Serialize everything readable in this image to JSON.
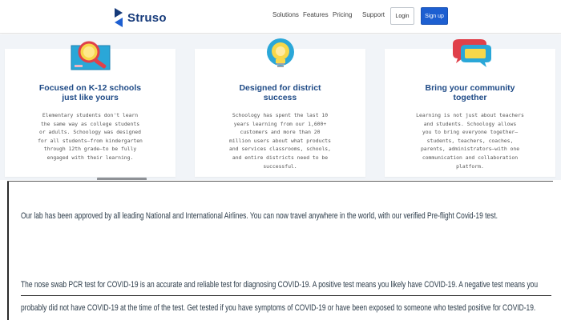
{
  "header": {
    "brand": "Struso",
    "nav": [
      "Solutions",
      "Features",
      "Pricing",
      "Support"
    ],
    "login_label": "Login",
    "signup_label": "Sign up",
    "colors": {
      "brand_blue": "#1d5fd1",
      "logo_dark": "#163a7a"
    }
  },
  "features": [
    {
      "title_line1": "Focused on K-12 schools",
      "title_line2": "just like yours",
      "icon": "magnifier-illustration-icon",
      "desc": [
        "Elementary students don't learn",
        "the same way as college students",
        "or adults. Schoology was designed",
        "for all students—from kindergarten",
        "through 12th grade—to be fully",
        "engaged with their learning."
      ]
    },
    {
      "title_line1": "Designed for district",
      "title_line2": "success",
      "icon": "lightbulb-illustration-icon",
      "desc": [
        "Schoology has spent the last 10",
        "years learning from our 1,600+",
        "customers and more than 20",
        "million users about what products",
        "and services classrooms, schools,",
        "and entire districts need to be",
        "successful."
      ]
    },
    {
      "title_line1": "Bring your community",
      "title_line2": "together",
      "icon": "chat-bubbles-illustration-icon",
      "desc": [
        "Learning is not just about teachers",
        "and students. Schoology allows",
        "you to bring everyone together—",
        "students, teachers, coaches,",
        "parents, administrators—with one",
        "communication and collaboration",
        "platform."
      ]
    }
  ],
  "covid": {
    "para1": "Our lab has been approved by all leading National and International Airlines. You can now travel anywhere in the world, with our verified Pre-flight Covid-19 test.",
    "para2_line1": "The nose swab PCR test for COVID-19 is an accurate and reliable test for diagnosing COVID-19. A positive test means you likely have COVID-19. A negative test means you",
    "para2_line2": "probably did not have COVID-19 at the time of the test. Get tested if you have symptoms of COVID-19 or have been exposed to someone who tested positive for COVID-19."
  }
}
